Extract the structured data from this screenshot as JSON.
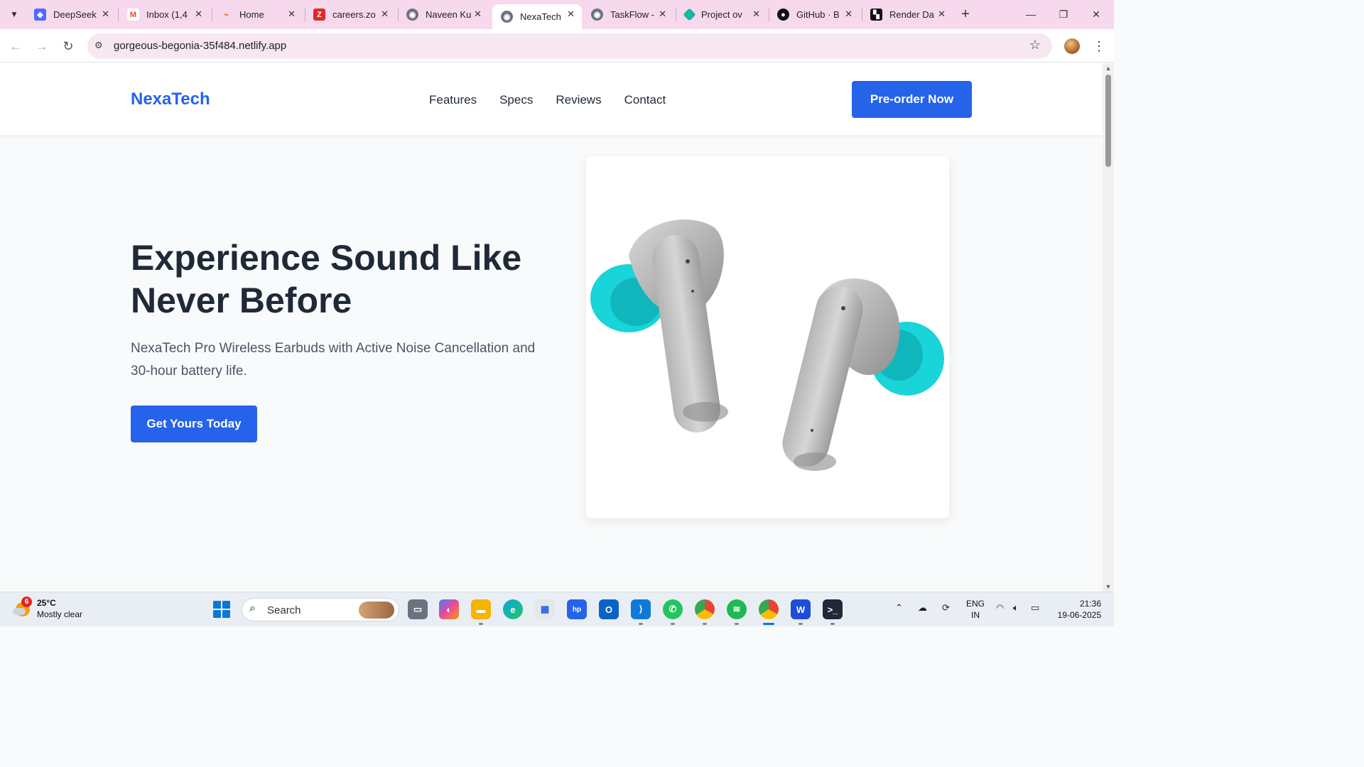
{
  "browser": {
    "tabs": [
      {
        "label": "DeepSeek",
        "active": false
      },
      {
        "label": "Inbox (1,4",
        "active": false
      },
      {
        "label": "Home",
        "active": false
      },
      {
        "label": "careers.zo",
        "active": false
      },
      {
        "label": "Naveen Ku",
        "active": false
      },
      {
        "label": "NexaTech",
        "active": true
      },
      {
        "label": "TaskFlow -",
        "active": false
      },
      {
        "label": "Project ov",
        "active": false
      },
      {
        "label": "GitHub · B",
        "active": false
      },
      {
        "label": "Render Da",
        "active": false
      }
    ],
    "url": "gorgeous-begonia-35f484.netlify.app"
  },
  "site": {
    "logo": "NexaTech",
    "nav": [
      "Features",
      "Specs",
      "Reviews",
      "Contact"
    ],
    "preorder_label": "Pre-order Now",
    "hero": {
      "title": "Experience Sound Like Never Before",
      "subtitle": "NexaTech Pro Wireless Earbuds with Active Noise Cancellation and 30-hour battery life.",
      "cta_label": "Get Yours Today"
    },
    "accent_color": "#2563eb"
  },
  "taskbar": {
    "weather": {
      "badge": "6",
      "temp": "25°C",
      "condition": "Mostly clear"
    },
    "search_placeholder": "Search",
    "lang_line1": "ENG",
    "lang_line2": "IN",
    "time": "21:36",
    "date": "19-06-2025"
  }
}
